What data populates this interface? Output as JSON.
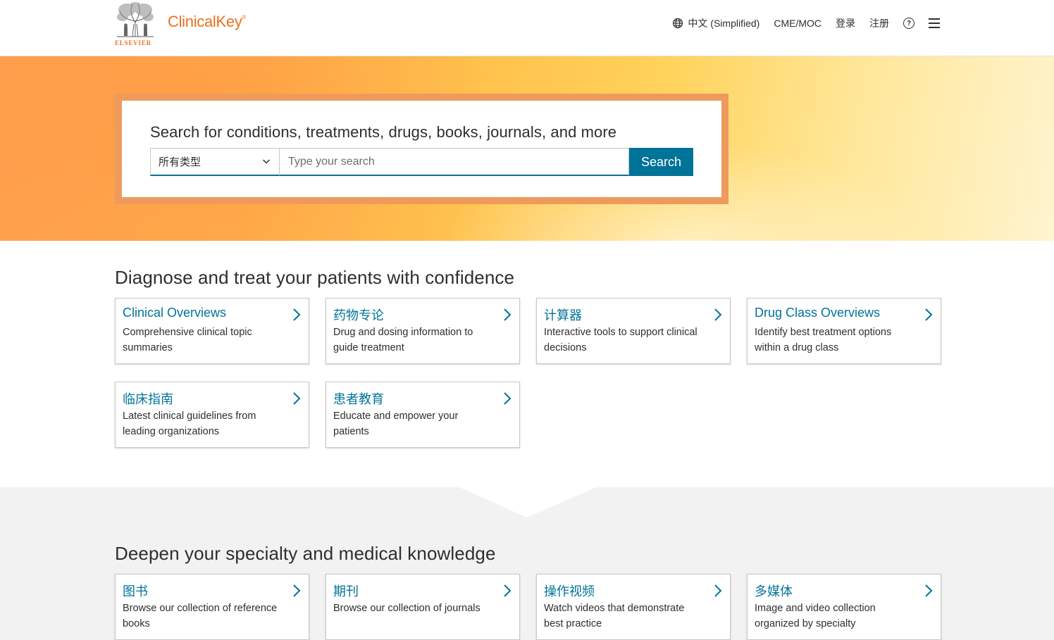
{
  "header": {
    "publisher": "ELSEVIER",
    "brand": "ClinicalKey",
    "brand_mark": "®",
    "nav": {
      "language": "中文 (Simplified)",
      "cme": "CME/MOC",
      "login": "登录",
      "register": "注册"
    },
    "icons": [
      "globe-icon",
      "help-icon",
      "menu-icon"
    ]
  },
  "search": {
    "heading": "Search for conditions, treatments, drugs, books, journals, and more",
    "type_selected": "所有类型",
    "placeholder": "Type your search",
    "button": "Search"
  },
  "diagnose": {
    "title": "Diagnose and treat your patients with confidence",
    "cards": [
      {
        "title": "Clinical Overviews",
        "desc": "Comprehensive clinical topic summaries"
      },
      {
        "title": "药物专论",
        "desc": "Drug and dosing information to guide treatment"
      },
      {
        "title": "计算器",
        "desc": "Interactive tools to support clinical decisions"
      },
      {
        "title": "Drug Class Overviews",
        "desc": "Identify best treatment options within a drug class"
      },
      {
        "title": "临床指南",
        "desc": "Latest clinical guidelines from leading organizations"
      },
      {
        "title": "患者教育",
        "desc": "Educate and empower your patients"
      }
    ]
  },
  "deepen": {
    "title": "Deepen your specialty and medical knowledge",
    "cards": [
      {
        "title": "图书",
        "desc": "Browse our collection of reference books"
      },
      {
        "title": "期刊",
        "desc": "Browse our collection of journals"
      },
      {
        "title": "操作视频",
        "desc": "Watch videos that demonstrate best practice"
      },
      {
        "title": "多媒体",
        "desc": "Image and video collection organized by specialty"
      }
    ]
  },
  "colors": {
    "accent": "#007398",
    "brand": "#e9711c",
    "search_frame": "#ef9a5d"
  }
}
